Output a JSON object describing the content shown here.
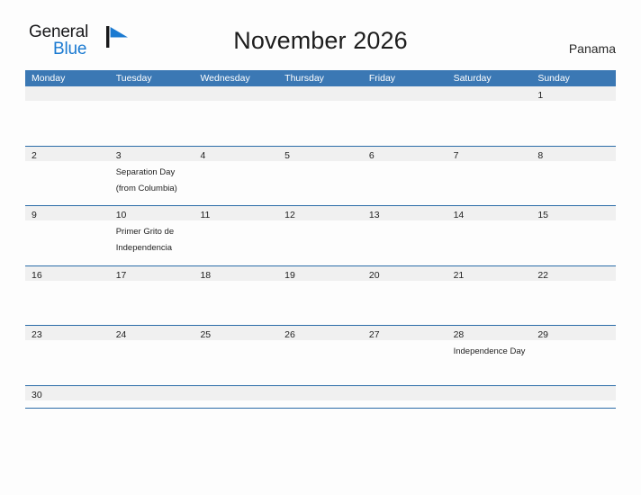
{
  "brand": {
    "name_part1": "General",
    "name_part2": "Blue",
    "flag_icon": "flag-triangle-icon",
    "pole_color": "#18181a",
    "flag_color": "#1b7ad1",
    "text_color_primary": "#18181a",
    "text_color_secondary": "#1b7ad1"
  },
  "header": {
    "title": "November 2026",
    "country": "Panama"
  },
  "colors": {
    "header_blue": "#3b78b4",
    "row_divider_blue": "#2b6ca8",
    "day_band_gray": "#f0f0f0",
    "page_background": "#fdfdfd",
    "text_dark": "#222222"
  },
  "calendar": {
    "weekdays": [
      "Monday",
      "Tuesday",
      "Wednesday",
      "Thursday",
      "Friday",
      "Saturday",
      "Sunday"
    ],
    "weeks": [
      {
        "days": [
          {
            "number": "",
            "event": ""
          },
          {
            "number": "",
            "event": ""
          },
          {
            "number": "",
            "event": ""
          },
          {
            "number": "",
            "event": ""
          },
          {
            "number": "",
            "event": ""
          },
          {
            "number": "",
            "event": ""
          },
          {
            "number": "1",
            "event": ""
          }
        ]
      },
      {
        "days": [
          {
            "number": "2",
            "event": ""
          },
          {
            "number": "3",
            "event": "Separation Day\n(from Columbia)"
          },
          {
            "number": "4",
            "event": ""
          },
          {
            "number": "5",
            "event": ""
          },
          {
            "number": "6",
            "event": ""
          },
          {
            "number": "7",
            "event": ""
          },
          {
            "number": "8",
            "event": ""
          }
        ]
      },
      {
        "days": [
          {
            "number": "9",
            "event": ""
          },
          {
            "number": "10",
            "event": "Primer Grito de\nIndependencia"
          },
          {
            "number": "11",
            "event": ""
          },
          {
            "number": "12",
            "event": ""
          },
          {
            "number": "13",
            "event": ""
          },
          {
            "number": "14",
            "event": ""
          },
          {
            "number": "15",
            "event": ""
          }
        ]
      },
      {
        "days": [
          {
            "number": "16",
            "event": ""
          },
          {
            "number": "17",
            "event": ""
          },
          {
            "number": "18",
            "event": ""
          },
          {
            "number": "19",
            "event": ""
          },
          {
            "number": "20",
            "event": ""
          },
          {
            "number": "21",
            "event": ""
          },
          {
            "number": "22",
            "event": ""
          }
        ]
      },
      {
        "days": [
          {
            "number": "23",
            "event": ""
          },
          {
            "number": "24",
            "event": ""
          },
          {
            "number": "25",
            "event": ""
          },
          {
            "number": "26",
            "event": ""
          },
          {
            "number": "27",
            "event": ""
          },
          {
            "number": "28",
            "event": "Independence Day"
          },
          {
            "number": "29",
            "event": ""
          }
        ]
      },
      {
        "last": true,
        "days": [
          {
            "number": "30",
            "event": ""
          },
          {
            "number": "",
            "event": ""
          },
          {
            "number": "",
            "event": ""
          },
          {
            "number": "",
            "event": ""
          },
          {
            "number": "",
            "event": ""
          },
          {
            "number": "",
            "event": ""
          },
          {
            "number": "",
            "event": ""
          }
        ]
      }
    ]
  }
}
